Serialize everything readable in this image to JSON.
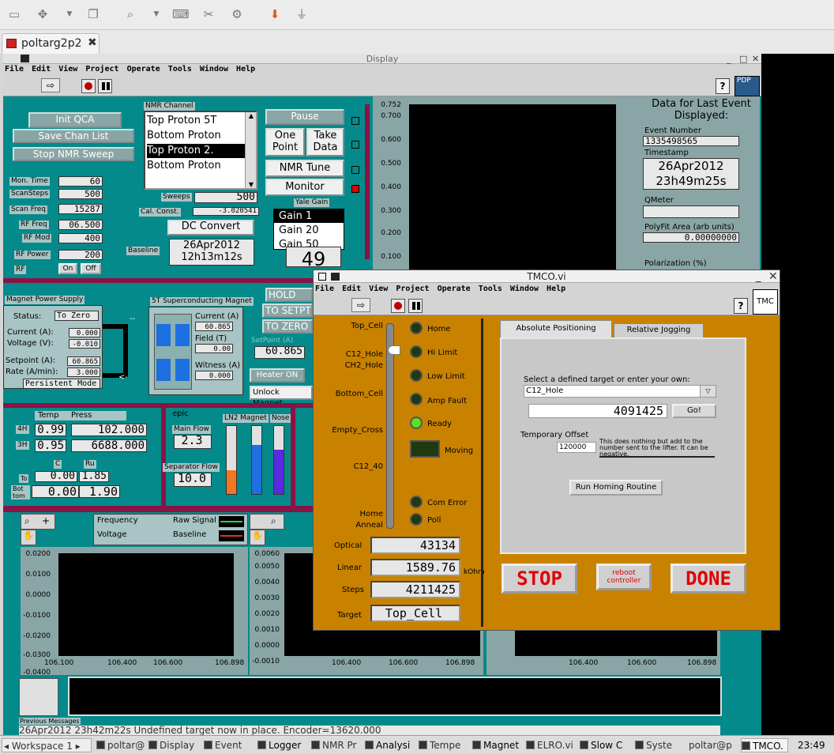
{
  "tab": {
    "title": "poltarg2p2"
  },
  "display": {
    "title": "Display",
    "menu": [
      "File",
      "Edit",
      "View",
      "Project",
      "Operate",
      "Tools",
      "Window",
      "Help"
    ],
    "buttons": {
      "init_qca": "Init QCA",
      "save_chan": "Save Chan List",
      "stop_nmr": "Stop NMR Sweep",
      "pause": "Pause",
      "one_point": "One Point",
      "take_data": "Take Data",
      "nmr_tune": "NMR Tune",
      "monitor": "Monitor",
      "dc_convert": "DC Convert"
    },
    "nmr_channel": {
      "label": "NMR Channel",
      "items": [
        "Top Proton 5T",
        "Bottom Proton",
        "Top Proton 2.",
        "Bottom Proton"
      ],
      "selected": 2
    },
    "params": [
      {
        "label": "Mon. Time",
        "value": "60"
      },
      {
        "label": "ScanSteps",
        "value": "500"
      },
      {
        "label": "Scan Freq",
        "value": "15287"
      },
      {
        "label": "RF Freq",
        "value": "06.500"
      },
      {
        "label": "RF Mod",
        "value": "400"
      },
      {
        "label": "RF Power",
        "value": "200"
      }
    ],
    "rf": {
      "label": "RF",
      "on": "On",
      "off": "Off"
    },
    "sweeps": {
      "label": "Sweeps",
      "value": "500"
    },
    "cal_const": {
      "label": "Cal. Const.",
      "value": "-3.020541"
    },
    "baseline": {
      "label": "Baseline",
      "date": "26Apr2012",
      "time": "12h13m12s"
    },
    "yale_gain": {
      "label": "Yale Gain",
      "items": [
        "Gain 1",
        "Gain 20",
        "Gain 50"
      ],
      "selected": 0,
      "counter": "49"
    },
    "graph_ticks": [
      "0.752",
      "0.700",
      "0.600",
      "0.500",
      "0.400",
      "0.300",
      "0.200",
      "0.100"
    ],
    "last_event": {
      "title": "Data for Last Event Displayed:",
      "event_label": "Event Number",
      "event_value": "1335498565",
      "timestamp_label": "Timestamp",
      "date": "26Apr2012",
      "time": "23h49m25s",
      "qmeter_label": "QMeter",
      "polyfit_label": "PolyFit Area (arb units)",
      "polyfit_value": "0.00000000",
      "polarization_label": "Polarization (%)"
    },
    "pdp": "PDP",
    "magnet_supply": {
      "title": "Magnet Power Supply",
      "status_label": "Status:",
      "status": "To Zero",
      "current_label": "Current (A):",
      "current": "0.000",
      "voltage_label": "Voltage (V):",
      "voltage": "-0.010",
      "setpoint_label": "Setpoint (A):",
      "setpoint": "60.865",
      "rate_label": "Rate (A/min):",
      "rate": "3.000",
      "mode": "Persistent Mode"
    },
    "sc_magnet": {
      "title": "5T Superconducting Magnet",
      "current_label": "Current (A)",
      "current": "60.865",
      "field_label": "Field (T)",
      "field": "0.00",
      "witness_label": "Witness (A)",
      "witness": "0.000"
    },
    "hold": {
      "hold": "HOLD",
      "to_setpt": "TO SETPT",
      "to_zero": "TO ZERO",
      "setpoint_label": "SetPoint (A)",
      "setpoint": "60.865",
      "heater": "Heater ON",
      "unlock": "Unlock Magnet"
    },
    "temps": {
      "temp_label": "Temp",
      "press_label": "Press",
      "r4h": "4H",
      "t4h": "0.99",
      "p4h": "102.000",
      "r3h": "3H",
      "t3h": "0.95",
      "p3h": "6688.000",
      "c_label": "C",
      "ru_label": "Ru",
      "to_label": "To",
      "to_c": "0.00",
      "to_ru": "1.85",
      "bot_label": "Bot tom",
      "bot_c": "0.00",
      "bot_ru": "1.90"
    },
    "epic": {
      "label": "epic",
      "main_flow_label": "Main Flow",
      "main_flow": "2.3",
      "sep_flow_label": "Separator Flow",
      "sep_flow": "10.0",
      "ln2": "LN2",
      "magnet": "Magnet",
      "nose": "Nose"
    },
    "bottom_graphs": {
      "frequency": "Frequency",
      "voltage": "Voltage",
      "raw_signal": "Raw Signal",
      "baseline": "Baseline",
      "ticks_left": [
        "0.0200",
        "0.0100",
        "0.0000",
        "-0.0100",
        "-0.0200",
        "-0.0300",
        "-0.0400"
      ],
      "ticks_mid": [
        "0.0060",
        "0.0050",
        "0.0040",
        "0.0030",
        "0.0020",
        "0.0010",
        "0.0000",
        "-0.0010"
      ],
      "x_ticks": [
        "106.100",
        "106.400",
        "106.600",
        "106.898"
      ]
    },
    "messages": {
      "label": "Previous Messages",
      "text": "26Apr2012 23h42m22s Undefined target now in place.  Encoder=13620.000"
    }
  },
  "tmco": {
    "title": "TMCO.vi",
    "menu": [
      "File",
      "Edit",
      "View",
      "Project",
      "Operate",
      "Tools",
      "Window",
      "Help"
    ],
    "badge": "TMC",
    "positions": [
      "Top_Cell",
      "C12_Hole",
      "CH2_Hole",
      "Bottom_Cell",
      "Empty_Cross",
      "C12_40",
      "Home",
      "Anneal"
    ],
    "leds": [
      {
        "label": "Home",
        "on": false
      },
      {
        "label": "Hi Limit",
        "on": false
      },
      {
        "label": "Low Limit",
        "on": false
      },
      {
        "label": "Amp Fault",
        "on": false
      },
      {
        "label": "Ready",
        "on": true
      }
    ],
    "moving": "Moving",
    "com_error": "Com Error",
    "poll": "Poll",
    "indicators": [
      {
        "label": "Optical",
        "value": "43134"
      },
      {
        "label": "Linear",
        "value": "1589.76"
      },
      {
        "label": "Steps",
        "value": "4211425"
      },
      {
        "label": "Target",
        "value": "Top_Cell"
      }
    ],
    "kohm": "kOhm",
    "tabs": [
      "Absolute Positioning",
      "Relative Jogging"
    ],
    "select_label": "Select a defined target or enter your own:",
    "target": "C12_Hole",
    "target_value": "4091425",
    "go": "Go!",
    "offset_label": "Temporary Offset",
    "offset_value": "120000",
    "offset_note": "This does nothing but add to the number sent to the lifter. It can be negative.",
    "homing": "Run Homing Routine",
    "stop": "STOP",
    "reboot": "reboot controller",
    "done": "DONE"
  },
  "taskbar": {
    "workspace": "Workspace 1",
    "items": [
      "poltar@p",
      "Display",
      "Event",
      "Logger",
      "NMR Pr",
      "Analysi",
      "Tempe",
      "Magnet",
      "ELRO.vi",
      "Slow C",
      "Syste",
      "poltar@p",
      "TMCO."
    ],
    "clock": "23:49"
  }
}
